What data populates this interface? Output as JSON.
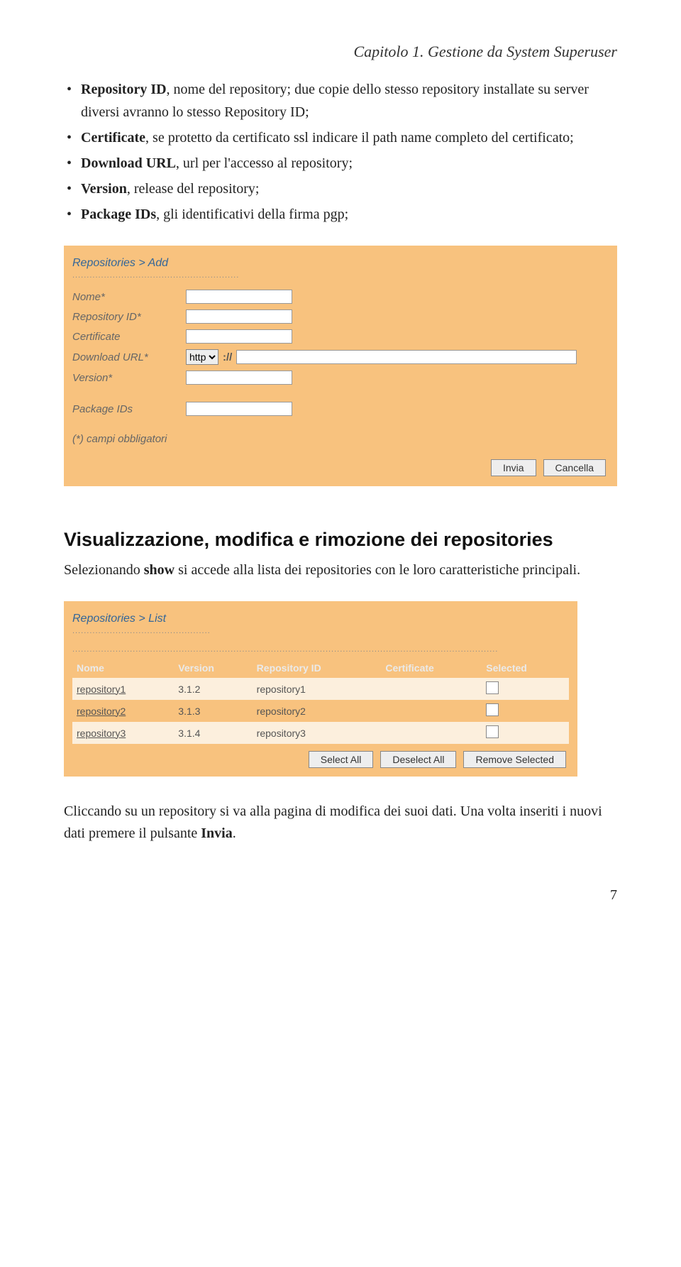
{
  "chapter_header": "Capitolo 1. Gestione da System Superuser",
  "bullets": [
    {
      "prefix_bold": "Repository ID",
      "rest": ", nome del repository; due copie dello stesso repository installate su server diversi avranno lo stesso Repository ID;"
    },
    {
      "prefix_bold": "Certificate",
      "rest": ", se protetto da certificato ssl indicare il path name completo del certificato;"
    },
    {
      "prefix_bold": "Download URL",
      "rest": ", url per l'accesso al repository;"
    },
    {
      "prefix_bold": "Version",
      "rest": ", release del repository;"
    },
    {
      "prefix_bold": "Package IDs",
      "rest": ", gli identificativi della firma pgp;"
    }
  ],
  "add_form": {
    "breadcrumb": "Repositories > Add",
    "labels": {
      "nome": "Nome*",
      "repo_id": "Repository ID*",
      "certificate": "Certificate",
      "download_url": "Download URL*",
      "version": "Version*",
      "package_ids": "Package IDs"
    },
    "protocol_selected": "http",
    "url_separator": "://",
    "required_note": "(*) campi obbligatori",
    "buttons": {
      "submit": "Invia",
      "cancel": "Cancella"
    }
  },
  "section": {
    "heading": "Visualizzazione, modifica e rimozione dei repositories",
    "intro_part1": "Selezionando ",
    "intro_bold": "show",
    "intro_part2": " si accede alla lista dei repositories con le loro caratteristiche principali."
  },
  "list_panel": {
    "breadcrumb": "Repositories > List",
    "headers": {
      "nome": "Nome",
      "version": "Version",
      "repo_id": "Repository ID",
      "certificate": "Certificate",
      "selected": "Selected"
    },
    "rows": [
      {
        "nome": "repository1",
        "version": "3.1.2",
        "repo_id": "repository1",
        "certificate": ""
      },
      {
        "nome": "repository2",
        "version": "3.1.3",
        "repo_id": "repository2",
        "certificate": ""
      },
      {
        "nome": "repository3",
        "version": "3.1.4",
        "repo_id": "repository3",
        "certificate": ""
      }
    ],
    "buttons": {
      "select_all": "Select All",
      "deselect_all": "Deselect All",
      "remove": "Remove Selected"
    }
  },
  "after_para_part1": "Cliccando su un repository si va alla pagina di modifica dei suoi dati. Una volta inseriti i nuovi dati premere il pulsante ",
  "after_para_bold": "Invia",
  "after_para_part2": ".",
  "page_number": "7"
}
